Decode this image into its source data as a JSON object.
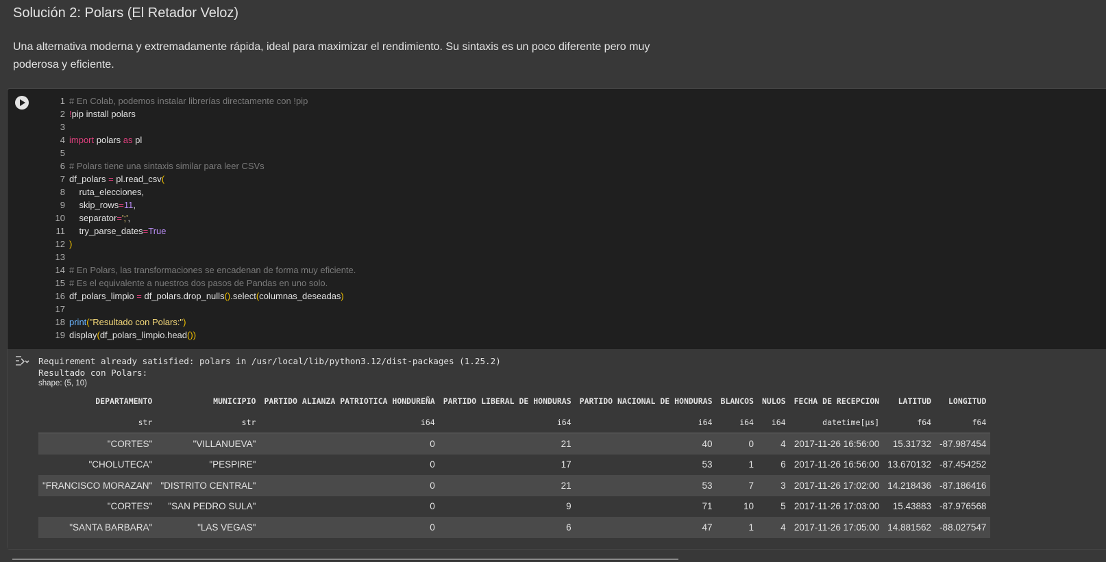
{
  "markdown": {
    "title": "Solución 2: Polars (El Retador Veloz)",
    "paragraph": "Una alternativa moderna y extremadamente rápida, ideal para maximizar el rendimiento. Su sintaxis es un poco diferente pero muy poderosa y eficiente."
  },
  "code_cell": {
    "run_icon": "play-circle-icon",
    "lines": [
      {
        "n": "1",
        "parts": [
          {
            "t": "# En Colab, podemos instalar librerías directamente con !pip",
            "c": "com"
          }
        ]
      },
      {
        "n": "2",
        "parts": [
          {
            "t": "!",
            "c": "op"
          },
          {
            "t": "pip install polars",
            "c": ""
          }
        ]
      },
      {
        "n": "3",
        "parts": []
      },
      {
        "n": "4",
        "parts": [
          {
            "t": "import",
            "c": "key"
          },
          {
            "t": " polars ",
            "c": ""
          },
          {
            "t": "as",
            "c": "key"
          },
          {
            "t": " pl",
            "c": ""
          }
        ]
      },
      {
        "n": "5",
        "parts": []
      },
      {
        "n": "6",
        "parts": [
          {
            "t": "# Polars tiene una sintaxis similar para leer CSVs",
            "c": "com"
          }
        ]
      },
      {
        "n": "7",
        "parts": [
          {
            "t": "df_polars ",
            "c": ""
          },
          {
            "t": "=",
            "c": "op"
          },
          {
            "t": " pl.read_csv",
            "c": ""
          },
          {
            "t": "(",
            "c": "par"
          }
        ]
      },
      {
        "n": "8",
        "parts": [
          {
            "t": "    ruta_elecciones,",
            "c": ""
          }
        ]
      },
      {
        "n": "9",
        "parts": [
          {
            "t": "    skip_rows",
            "c": ""
          },
          {
            "t": "=",
            "c": "op"
          },
          {
            "t": "11",
            "c": "num"
          },
          {
            "t": ",",
            "c": ""
          }
        ]
      },
      {
        "n": "10",
        "parts": [
          {
            "t": "    separator",
            "c": ""
          },
          {
            "t": "=",
            "c": "op"
          },
          {
            "t": "';'",
            "c": "str"
          },
          {
            "t": ",",
            "c": ""
          }
        ]
      },
      {
        "n": "11",
        "parts": [
          {
            "t": "    try_parse_dates",
            "c": ""
          },
          {
            "t": "=",
            "c": "op"
          },
          {
            "t": "True",
            "c": "num"
          }
        ]
      },
      {
        "n": "12",
        "parts": [
          {
            "t": ")",
            "c": "par"
          }
        ]
      },
      {
        "n": "13",
        "parts": []
      },
      {
        "n": "14",
        "parts": [
          {
            "t": "# En Polars, las transformaciones se encadenan de forma muy eficiente.",
            "c": "com"
          }
        ]
      },
      {
        "n": "15",
        "parts": [
          {
            "t": "# Es el equivalente a nuestros dos pasos de Pandas en uno solo.",
            "c": "com"
          }
        ]
      },
      {
        "n": "16",
        "parts": [
          {
            "t": "df_polars_limpio ",
            "c": ""
          },
          {
            "t": "=",
            "c": "op"
          },
          {
            "t": " df_polars.drop_nulls",
            "c": ""
          },
          {
            "t": "()",
            "c": "par"
          },
          {
            "t": ".select",
            "c": ""
          },
          {
            "t": "(",
            "c": "par"
          },
          {
            "t": "columnas_deseadas",
            "c": ""
          },
          {
            "t": ")",
            "c": "par"
          }
        ]
      },
      {
        "n": "17",
        "parts": []
      },
      {
        "n": "18",
        "parts": [
          {
            "t": "print",
            "c": "fn"
          },
          {
            "t": "(",
            "c": "par"
          },
          {
            "t": "\"Resultado con Polars:\"",
            "c": "str"
          },
          {
            "t": ")",
            "c": "par"
          }
        ]
      },
      {
        "n": "19",
        "parts": [
          {
            "t": "display",
            "c": ""
          },
          {
            "t": "(",
            "c": "par"
          },
          {
            "t": "df_polars_limpio.head",
            "c": ""
          },
          {
            "t": "()",
            "c": "par"
          },
          {
            "t": ")",
            "c": "par"
          }
        ]
      }
    ]
  },
  "output": {
    "icon": "output-toggle-icon",
    "stdout": "Requirement already satisfied: polars in /usr/local/lib/python3.12/dist-packages (1.25.2)\nResultado con Polars:",
    "shape": "shape: (5, 10)",
    "table": {
      "columns": [
        "DEPARTAMENTO",
        "MUNICIPIO",
        "PARTIDO ALIANZA PATRIOTICA HONDUREÑA",
        "PARTIDO LIBERAL DE HONDURAS",
        "PARTIDO NACIONAL DE HONDURAS",
        "BLANCOS",
        "NULOS",
        "FECHA DE RECEPCION",
        "LATITUD",
        "LONGITUD"
      ],
      "dtypes": [
        "str",
        "str",
        "i64",
        "i64",
        "i64",
        "i64",
        "i64",
        "datetime[μs]",
        "f64",
        "f64"
      ],
      "rows": [
        [
          "\"CORTES\"",
          "\"VILLANUEVA\"",
          "0",
          "21",
          "40",
          "0",
          "4",
          "2017-11-26 16:56:00",
          "15.31732",
          "-87.987454"
        ],
        [
          "\"CHOLUTECA\"",
          "\"PESPIRE\"",
          "0",
          "17",
          "53",
          "1",
          "6",
          "2017-11-26 16:56:00",
          "13.670132",
          "-87.454252"
        ],
        [
          "\"FRANCISCO MORAZAN\"",
          "\"DISTRITO CENTRAL\"",
          "0",
          "21",
          "53",
          "7",
          "3",
          "2017-11-26 17:02:00",
          "14.218436",
          "-87.186416"
        ],
        [
          "\"CORTES\"",
          "\"SAN PEDRO SULA\"",
          "0",
          "9",
          "71",
          "10",
          "5",
          "2017-11-26 17:03:00",
          "15.43883",
          "-87.976568"
        ],
        [
          "\"SANTA BARBARA\"",
          "\"LAS VEGAS\"",
          "0",
          "6",
          "47",
          "1",
          "4",
          "2017-11-26 17:05:00",
          "14.881562",
          "-88.027547"
        ]
      ]
    }
  }
}
